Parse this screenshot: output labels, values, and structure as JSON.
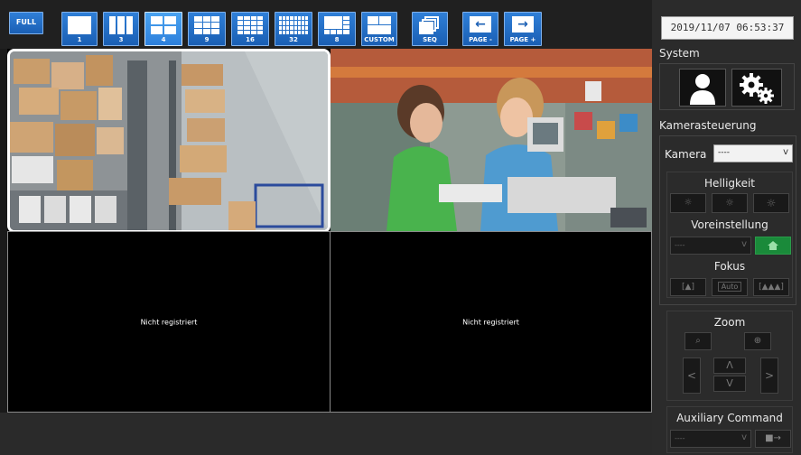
{
  "toolbar": {
    "full_label": "FULL",
    "layout_buttons": [
      {
        "label": "1",
        "active": false
      },
      {
        "label": "3",
        "active": false
      },
      {
        "label": "4",
        "active": true
      },
      {
        "label": "9",
        "active": false
      },
      {
        "label": "16",
        "active": false
      },
      {
        "label": "32",
        "active": false
      },
      {
        "label": "8",
        "active": false
      },
      {
        "label": "CUSTOM",
        "active": false
      }
    ],
    "seq_label": "SEQ",
    "page_prev_label": "PAGE -",
    "page_next_label": "PAGE +"
  },
  "grid": {
    "empty_message": "Nicht registriert"
  },
  "panel": {
    "clock": "2019/11/07 06:53:37",
    "system_title": "System",
    "camera_control_title": "Kamerasteuerung",
    "camera_label": "Kamera",
    "camera_value": "----",
    "brightness_label": "Helligkeit",
    "preset_label": "Voreinstellung",
    "preset_value": "----",
    "focus_label": "Fokus",
    "focus_auto_label": "Auto",
    "zoom_label": "Zoom",
    "aux_label": "Auxiliary Command",
    "aux_value": "----"
  }
}
